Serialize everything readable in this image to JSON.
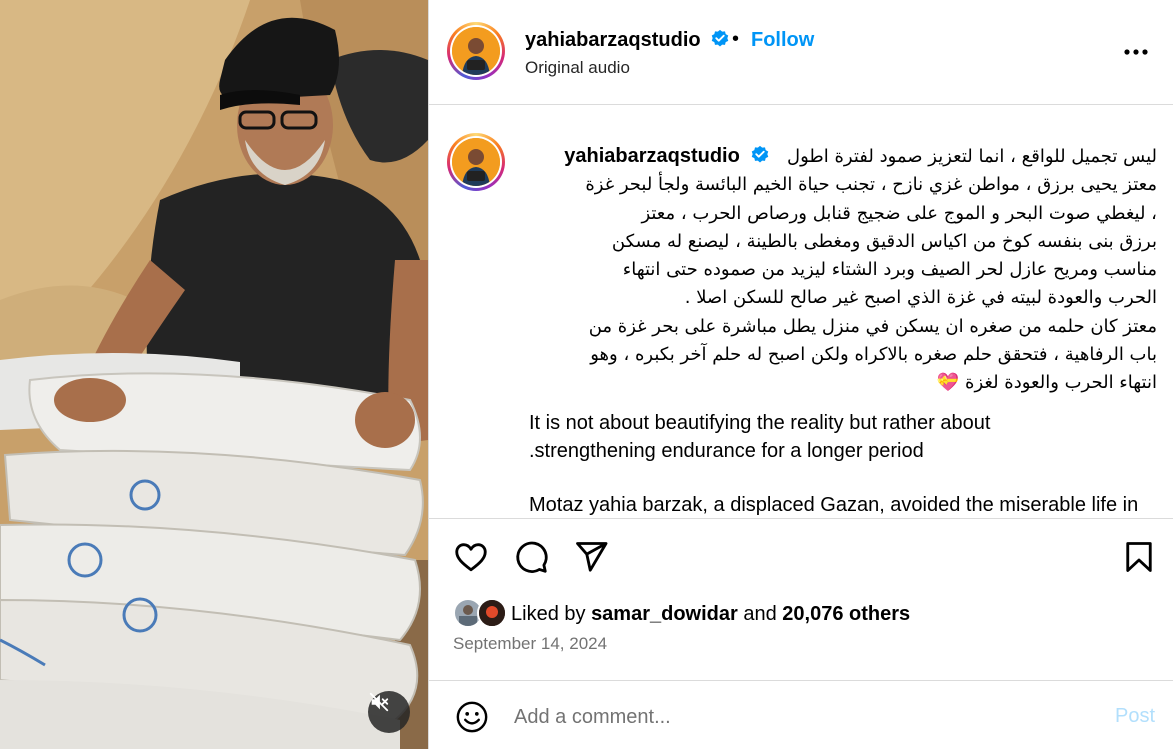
{
  "post": {
    "username": "yahiabarzaqstudio",
    "follow_label": "Follow",
    "separator": "•",
    "audio_label": "Original audio",
    "verified_icon": "verified-badge-icon",
    "more_icon": "more-options-icon"
  },
  "caption": {
    "username": "yahiabarzaqstudio",
    "arabic_lines": [
      "ليس تجميل للواقع ، انما لتعزيز صمود لفترة اطول",
      "معتز يحيى برزق ، مواطن غزي نازح ، تجنب حياة الخيم البائسة ولجأ لبحر غزة",
      "، ليغطي صوت البحر و الموج على ضجيج قنابل ورصاص الحرب ، معتز",
      "برزق بنى بنفسه كوخ من اكياس الدقيق ومغطى بالطينة ، ليصنع له مسكن",
      "مناسب ومريح عازل لحر الصيف وبرد الشتاء ليزيد من صموده حتى انتهاء",
      "الحرب والعودة لبيته في غزة الذي اصبح غير صالح للسكن اصلا .",
      "معتز كان حلمه من صغره ان يسكن في منزل يطل مباشرة على بحر غزة من",
      "باب الرفاهية ، فتحقق حلم صغره بالاكراه ولكن اصبح له حلم آخر بكبره ، وهو",
      "انتهاء الحرب والعودة لغزة 💝"
    ],
    "english_paragraphs": [
      "It is not about beautifying the reality but rather about .strengthening endurance for a longer period",
      "Motaz yahia barzak, a displaced Gazan, avoided the miserable life in"
    ]
  },
  "actions": {
    "like_icon": "heart-icon",
    "comment_icon": "comment-icon",
    "share_icon": "share-icon",
    "save_icon": "bookmark-icon"
  },
  "likes": {
    "prefix": "Liked by",
    "user": "samar_dowidar",
    "and": "and",
    "others": "20,076 others"
  },
  "date": "September 14, 2024",
  "comment": {
    "placeholder": "Add a comment...",
    "post_label": "Post",
    "emoji_icon": "emoji-icon"
  },
  "media": {
    "mute_icon": "speaker-muted-icon"
  },
  "colors": {
    "link_blue": "#0095f6",
    "post_disabled": "#b2dffc",
    "muted_text": "#737373",
    "border": "#dbdbdb"
  }
}
